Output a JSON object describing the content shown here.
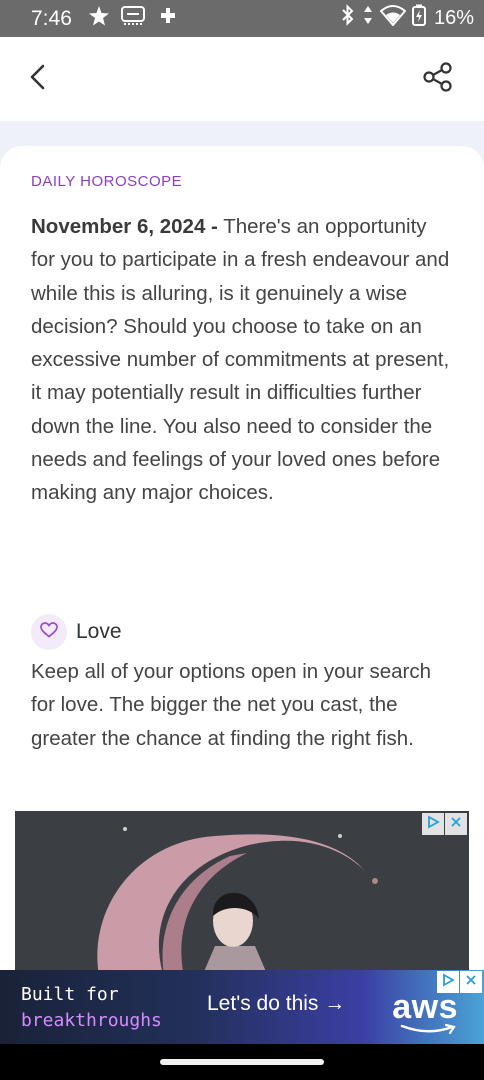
{
  "status_bar": {
    "time": "7:46",
    "battery_percent": "16%",
    "left_icons": [
      "star-icon",
      "app-notification-icon",
      "game-controller-icon"
    ],
    "right_icons": [
      "bluetooth-icon",
      "data-arrows-icon",
      "wifi-icon",
      "battery-icon"
    ]
  },
  "app_bar": {
    "back_icon": "chevron-left-icon",
    "share_icon": "share-icon"
  },
  "card": {
    "section_label": "DAILY HOROSCOPE",
    "date_prefix": "November 6, 2024 -",
    "horoscope_text": " There's an opportunity for you to participate in a fresh endeavour and while this is alluring, is it genuinely a wise decision? Should you choose to take on an excessive number of commitments at present, it may potentially result in difficulties further down the line. You also need to consider the needs and feelings of your loved ones before making any major choices.",
    "love": {
      "title": "Love",
      "icon": "heart-icon",
      "text": "Keep all of your options open in your search for love. The bigger the net you cast, the greater the chance at finding the right fish."
    }
  },
  "bottom_ad": {
    "line1": "Built for",
    "line2": "breakthroughs",
    "cta": "Let's do this →",
    "logo": "aws"
  },
  "colors": {
    "accent": "#8a3fbf",
    "status_bar": "#6b6b6b",
    "page_background": "#eef1f8"
  }
}
